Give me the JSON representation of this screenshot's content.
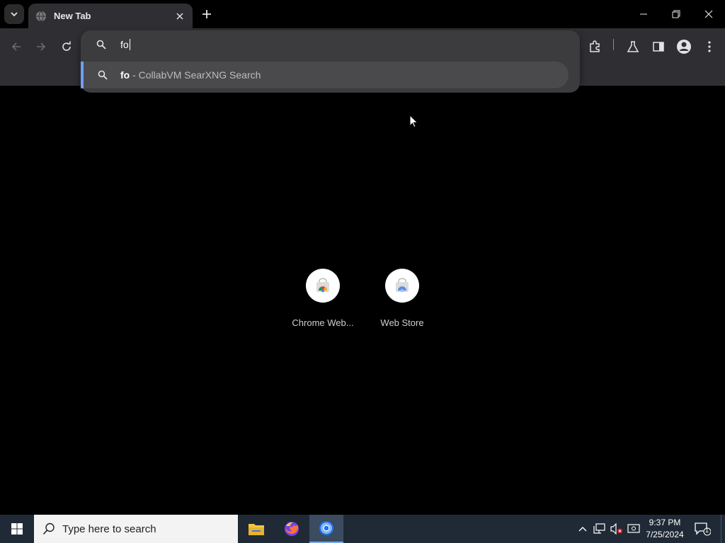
{
  "browser": {
    "tab": {
      "title": "New Tab"
    },
    "omnibox": {
      "value": "fo",
      "suggestion": {
        "match": "fo",
        "rest": " - CollabVM SearXNG Search"
      }
    },
    "shortcuts": [
      {
        "label": "Chrome Web..."
      },
      {
        "label": "Web Store"
      }
    ]
  },
  "taskbar": {
    "search_placeholder": "Type here to search",
    "clock": {
      "time": "9:37 PM",
      "date": "7/25/2024"
    },
    "notification_count": "1"
  },
  "colors": {
    "accent": "#6f9ff7",
    "toolbar": "#2f2f33",
    "omnibox": "#3c3c3f",
    "taskbar": "#1f2a36"
  }
}
